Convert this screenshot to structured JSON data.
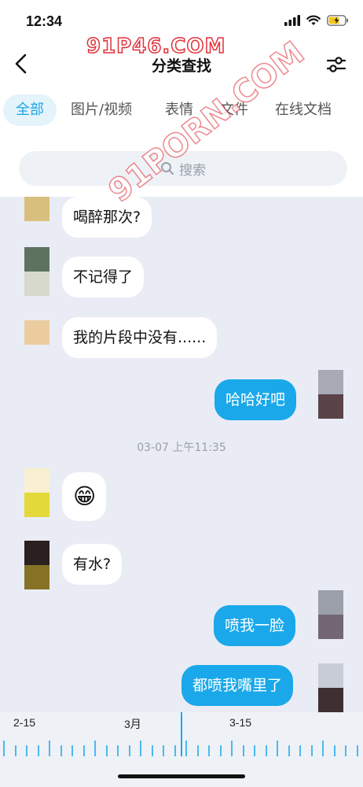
{
  "status": {
    "time": "12:34"
  },
  "watermark": {
    "top": "91P46.COM",
    "diagonal": "91PORN.COM"
  },
  "header": {
    "title": "分类查找"
  },
  "tabs": [
    "全部",
    "图片/视频",
    "表情",
    "文件",
    "在线文档"
  ],
  "search": {
    "placeholder": "搜索"
  },
  "messages": [
    {
      "side": "in",
      "text": "喝醉那次?"
    },
    {
      "side": "in",
      "text": "不记得了"
    },
    {
      "side": "in",
      "text": "我的片段中没有......"
    },
    {
      "side": "out",
      "text": "哈哈好吧"
    },
    {
      "side": "in",
      "text": "😁"
    },
    {
      "side": "in",
      "text": "有水?"
    },
    {
      "side": "out",
      "text": "喷我一脸"
    },
    {
      "side": "out",
      "text": "都喷我嘴里了"
    }
  ],
  "timestamp": "03-07 上午11:35",
  "timeline": {
    "labels": [
      "2-15",
      "3月",
      "3-15"
    ]
  },
  "colors": {
    "accent": "#1aa8ea",
    "chat_bg": "#e9ecf4",
    "tab_active_bg": "#e5f3fb"
  }
}
